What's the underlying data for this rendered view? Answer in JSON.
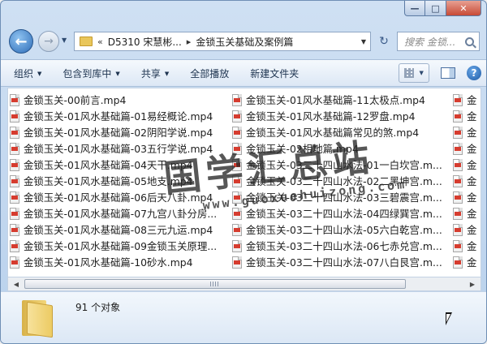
{
  "window": {
    "caption_min": "—",
    "caption_max": "□",
    "caption_close": "✕"
  },
  "nav": {
    "back_glyph": "←",
    "forward_glyph": "→",
    "breadcrumb_prefix": "«",
    "breadcrumb": [
      "D5310 宋慧彬...",
      "金锁玉关基础及案例篇"
    ],
    "refresh_glyph": "↻",
    "search_placeholder": "搜索 金锁..."
  },
  "toolbar": {
    "organize": "组织",
    "include_in_library": "包含到库中",
    "share": "共享",
    "play_all": "全部播放",
    "new_folder": "新建文件夹",
    "help": "?"
  },
  "files": {
    "column1": [
      "金锁玉关-00前言.mp4",
      "金锁玉关-01风水基础篇-01易经概论.mp4",
      "金锁玉关-01风水基础篇-02阴阳学说.mp4",
      "金锁玉关-01风水基础篇-03五行学说.mp4",
      "金锁玉关-01风水基础篇-04天干.mp4",
      "金锁玉关-01风水基础篇-05地支.mp4",
      "金锁玉关-01风水基础篇-06后天八卦.mp4",
      "金锁玉关-01风水基础篇-07九宫八卦分房...",
      "金锁玉关-01风水基础篇-08三元九运.mp4",
      "金锁玉关-01风水基础篇-09金锁玉关原理...",
      "金锁玉关-01风水基础篇-10砂水.mp4"
    ],
    "column2": [
      "金锁玉关-01风水基础篇-11太极点.mp4",
      "金锁玉关-01风水基础篇-12罗盘.mp4",
      "金锁玉关-01风水基础篇常见的煞.mp4",
      "金锁玉关-02相地篇.mp4",
      "金锁玉关-03二十四山水法-01一白坎宫.m...",
      "金锁玉关-03二十四山水法-02二黑坤宫.m...",
      "金锁玉关-03二十四山水法-03三碧震宫.m...",
      "金锁玉关-03二十四山水法-04四绿巽宫.m...",
      "金锁玉关-03二十四山水法-05六白乾宫.m...",
      "金锁玉关-03二十四山水法-06七赤兑宫.m...",
      "金锁玉关-03二十四山水法-07八白艮宫.m..."
    ],
    "column3": [
      "金",
      "金",
      "金",
      "金",
      "金",
      "金",
      "金",
      "金",
      "金",
      "金",
      "金"
    ]
  },
  "watermark": {
    "text": "国学汇总站",
    "url": "www.guoxuehuizong.com"
  },
  "scroll": {
    "left_glyph": "◀",
    "right_glyph": "▶"
  },
  "details": {
    "count": "91 个对象"
  }
}
